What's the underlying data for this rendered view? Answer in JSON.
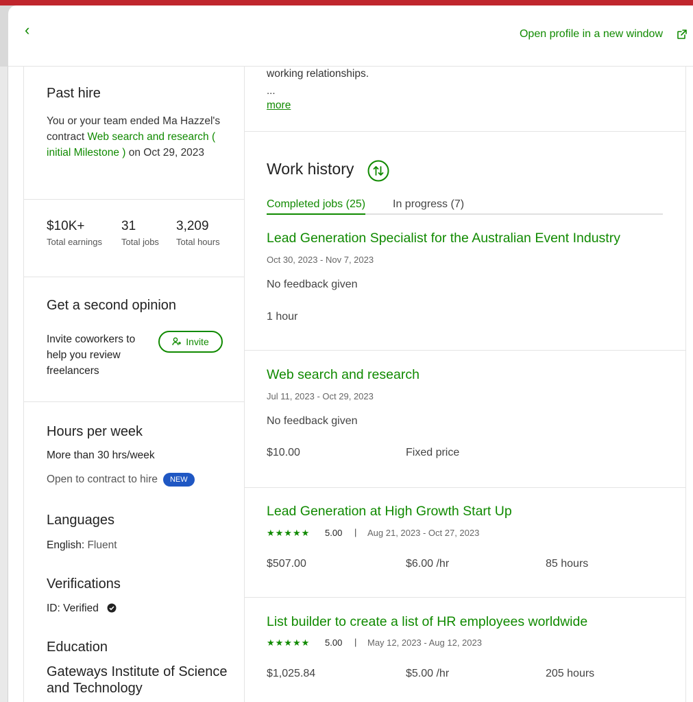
{
  "header": {
    "back_label": "‹",
    "open_profile": "Open profile in a new window"
  },
  "past_hire": {
    "title": "Past hire",
    "text_before": "You or your team ended Ma Hazzel's contract ",
    "contract_link": "Web search and research ( initial Milestone )",
    "text_after": " on Oct 29, 2023"
  },
  "stats": [
    {
      "value": "$10K+",
      "label": "Total earnings"
    },
    {
      "value": "31",
      "label": "Total jobs"
    },
    {
      "value": "3,209",
      "label": "Total hours"
    }
  ],
  "second_opinion": {
    "title": "Get a second opinion",
    "text": "Invite coworkers to help you review freelancers",
    "invite_label": "Invite"
  },
  "hours": {
    "title": "Hours per week",
    "value": "More than 30 hrs/week",
    "contract_to_hire": "Open to contract to hire",
    "badge": "NEW"
  },
  "languages": {
    "title": "Languages",
    "language": "English:",
    "level": "Fluent"
  },
  "verifications": {
    "title": "Verifications",
    "id_text": "ID: Verified"
  },
  "education": {
    "title": "Education",
    "school": "Gateways Institute of Science and Technology"
  },
  "bio": {
    "cut_text": "working relationships.",
    "ellipsis": "...",
    "more": "more"
  },
  "work_history": {
    "title": "Work history",
    "tabs": [
      {
        "label": "Completed jobs (25)"
      },
      {
        "label": "In progress (7)"
      }
    ],
    "jobs": [
      {
        "title": "Lead Generation Specialist for the Australian Event Industry",
        "dates": "Oct 30, 2023 - Nov 7, 2023",
        "feedback": "No feedback given",
        "col1": "1 hour"
      },
      {
        "title": "Web search and research",
        "dates": "Jul 11, 2023 - Oct 29, 2023",
        "feedback": "No feedback given",
        "col1": "$10.00",
        "col2": "Fixed price"
      },
      {
        "title": "Lead Generation at High Growth Start Up",
        "stars": "★★★★★",
        "rating": "5.00",
        "sep": "|",
        "dates": "Aug 21, 2023 - Oct 27, 2023",
        "col1": "$507.00",
        "col2": "$6.00 /hr",
        "col3": "85 hours"
      },
      {
        "title": "List builder to create a list of HR employees worldwide",
        "stars": "★★★★★",
        "rating": "5.00",
        "sep": "|",
        "dates": "May 12, 2023 - Aug 12, 2023",
        "col1": "$1,025.84",
        "col2": "$5.00 /hr",
        "col3": "205 hours"
      }
    ]
  },
  "colors": {
    "accent": "#108a00",
    "badge": "#1f57c3",
    "topbar": "#c0262d"
  }
}
